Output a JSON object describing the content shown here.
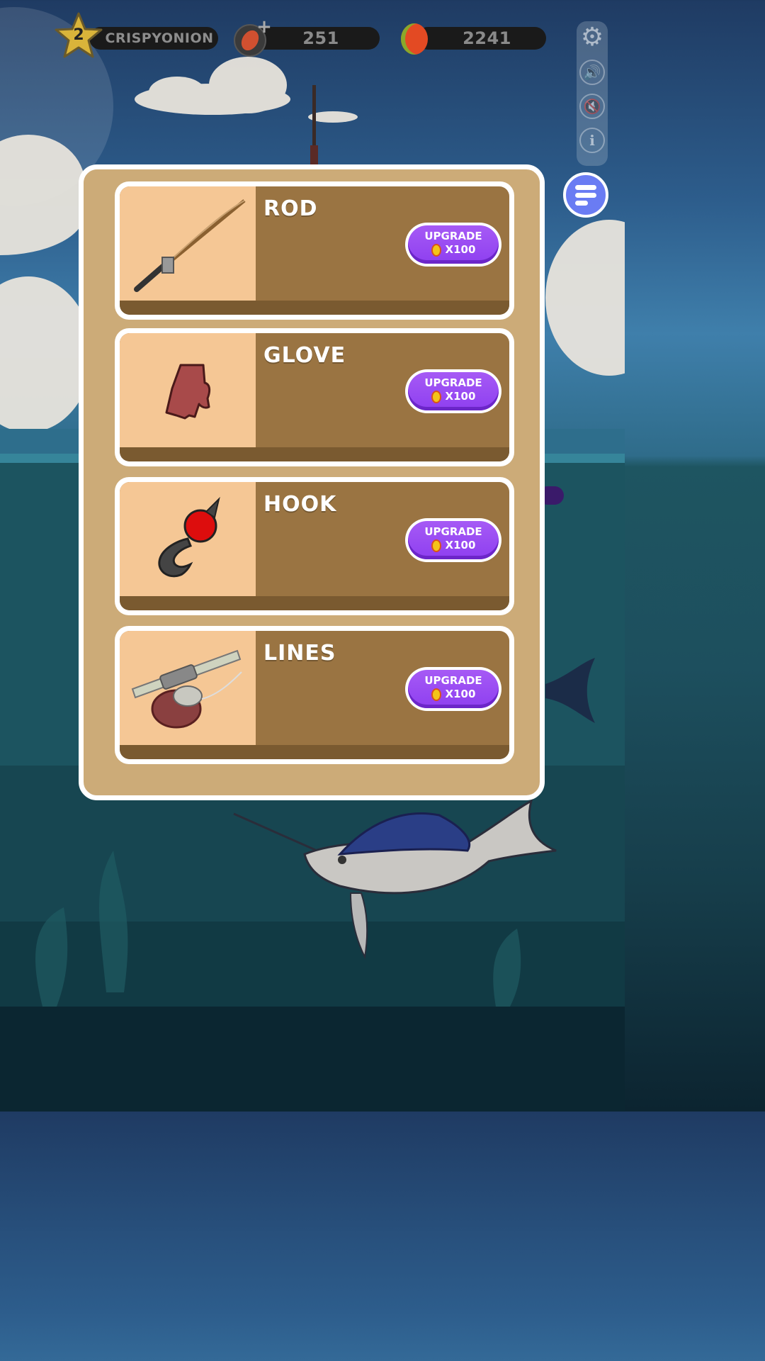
{
  "hud": {
    "level": "2",
    "username": "CRISPYONION",
    "bait_count": "251",
    "coins": "2241"
  },
  "side_buttons": [
    "settings-icon",
    "sound-icon",
    "mute-icon",
    "info-icon"
  ],
  "colors": {
    "panel_bg": "#ccab78",
    "card_bg": "#9a7442",
    "image_bg": "#f5c795",
    "upgrade_purple": "#9346f2",
    "menu_blue": "#6a7cf3"
  },
  "upgrades": [
    {
      "title": "ROD",
      "button_label": "UPGRADE",
      "cost": "X100",
      "icon": "fishing-rod-icon"
    },
    {
      "title": "GLOVE",
      "button_label": "UPGRADE",
      "cost": "X100",
      "icon": "glove-icon"
    },
    {
      "title": "HOOK",
      "button_label": "UPGRADE",
      "cost": "X100",
      "icon": "hook-icon"
    },
    {
      "title": "LINES",
      "button_label": "UPGRADE",
      "cost": "X100",
      "icon": "reel-icon"
    }
  ]
}
